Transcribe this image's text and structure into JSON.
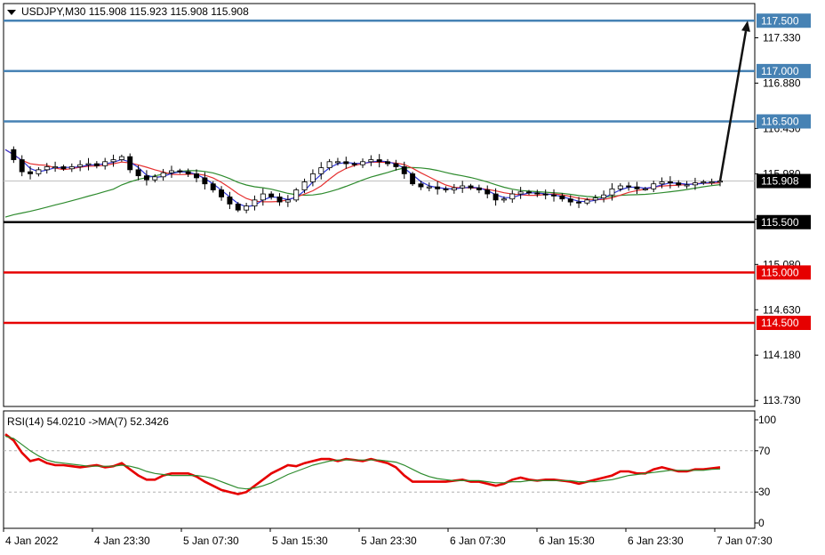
{
  "chart_data": [
    {
      "type": "candlestick",
      "title": "USDJPY,M30  115.908 115.923 115.908 115.908",
      "symbol": "USDJPY,M30",
      "ohlc_header": "115.908 115.923 115.908 115.908",
      "y_ticks": [
        117.33,
        116.88,
        116.43,
        115.98,
        115.53,
        115.08,
        114.63,
        114.18,
        113.73
      ],
      "y_tick_labels": [
        "117.330",
        "116.880",
        "116.430",
        "115.980",
        "115.530",
        "115.080",
        "114.630",
        "114.180",
        "113.730"
      ],
      "ylim": [
        113.67,
        117.67
      ],
      "x_tick_labels": [
        "4 Jan 2022",
        "4 Jan 23:30",
        "5 Jan 07:30",
        "5 Jan 15:30",
        "5 Jan 23:30",
        "6 Jan 07:30",
        "6 Jan 15:30",
        "6 Jan 23:30",
        "7 Jan 07:30"
      ],
      "current_price": 115.908,
      "current_price_label": "115.908",
      "levels": [
        {
          "value": 117.5,
          "label": "117.500",
          "color": "#4682b4"
        },
        {
          "value": 117.0,
          "label": "117.000",
          "color": "#4682b4"
        },
        {
          "value": 116.5,
          "label": "116.500",
          "color": "#4682b4"
        },
        {
          "value": 115.5,
          "label": "115.500",
          "color": "#000000"
        },
        {
          "value": 115.0,
          "label": "115.000",
          "color": "#e60000"
        },
        {
          "value": 114.5,
          "label": "114.500",
          "color": "#e60000"
        }
      ],
      "projection_arrow": {
        "from": 115.908,
        "to": 117.5
      },
      "price_path": [
        116.22,
        116.12,
        116.0,
        115.98,
        116.02,
        116.05,
        116.05,
        116.03,
        116.05,
        116.07,
        116.08,
        116.06,
        116.1,
        116.12,
        116.15,
        116.02,
        115.96,
        115.92,
        115.95,
        115.99,
        116.01,
        116.0,
        115.98,
        115.94,
        115.88,
        115.82,
        115.75,
        115.68,
        115.62,
        115.66,
        115.72,
        115.78,
        115.75,
        115.7,
        115.72,
        115.82,
        115.9,
        115.98,
        116.04,
        116.1,
        116.1,
        116.08,
        116.07,
        116.1,
        116.12,
        116.1,
        116.08,
        116.05,
        115.98,
        115.88,
        115.85,
        115.85,
        115.83,
        115.82,
        115.84,
        115.86,
        115.84,
        115.82,
        115.78,
        115.72,
        115.73,
        115.78,
        115.8,
        115.79,
        115.78,
        115.77,
        115.76,
        115.73,
        115.7,
        115.69,
        115.72,
        115.74,
        115.77,
        115.83,
        115.86,
        115.85,
        115.83,
        115.83,
        115.88,
        115.9,
        115.89,
        115.87,
        115.87,
        115.89,
        115.9,
        115.9,
        115.908
      ],
      "ma_fast_color": "#2e35d6",
      "ma_mid_color": "#e53030",
      "ma_slow_color": "#2e8b2e"
    },
    {
      "type": "line",
      "title": "RSI(14) 54.0210  ->MA(7) 52.3426",
      "ylim": [
        0,
        100
      ],
      "y_ticks": [
        100,
        70,
        30,
        0
      ],
      "y_tick_labels": [
        "100",
        "70",
        "30",
        "0"
      ],
      "reference_levels": [
        70,
        30
      ],
      "series": [
        {
          "name": "RSI(14)",
          "color": "#e60000",
          "values": [
            86,
            80,
            68,
            60,
            62,
            58,
            56,
            56,
            55,
            54,
            55,
            56,
            54,
            55,
            58,
            52,
            46,
            42,
            42,
            46,
            48,
            48,
            48,
            45,
            40,
            36,
            32,
            30,
            28,
            30,
            36,
            42,
            48,
            52,
            56,
            55,
            58,
            60,
            62,
            62,
            60,
            62,
            61,
            60,
            62,
            60,
            58,
            54,
            46,
            40,
            40,
            40,
            40,
            40,
            41,
            42,
            40,
            40,
            38,
            36,
            38,
            42,
            44,
            42,
            41,
            42,
            42,
            41,
            40,
            38,
            40,
            42,
            44,
            46,
            50,
            50,
            48,
            48,
            52,
            54,
            52,
            50,
            50,
            52,
            52,
            53,
            54
          ]
        },
        {
          "name": "MA(7)",
          "color": "#2e8b2e",
          "values": [
            84,
            82,
            76,
            70,
            65,
            61,
            59,
            58,
            57,
            56,
            55,
            55,
            55,
            55,
            56,
            55,
            53,
            50,
            48,
            47,
            46,
            46,
            46,
            46,
            45,
            43,
            40,
            37,
            34,
            33,
            34,
            36,
            39,
            43,
            47,
            50,
            53,
            56,
            58,
            60,
            61,
            61,
            61,
            61,
            61,
            61,
            60,
            59,
            56,
            52,
            48,
            45,
            43,
            42,
            41,
            41,
            41,
            41,
            40,
            39,
            39,
            40,
            40,
            41,
            41,
            41,
            41,
            41,
            41,
            40,
            40,
            40,
            41,
            42,
            44,
            46,
            47,
            48,
            49,
            50,
            51,
            51,
            51,
            51,
            51,
            52,
            52.3
          ]
        }
      ]
    }
  ]
}
